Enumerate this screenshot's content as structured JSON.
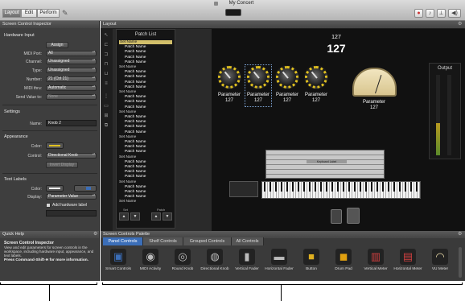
{
  "window": {
    "title": "My Concert"
  },
  "toolbar": {
    "modes": [
      "Layout",
      "Edit",
      "Perform"
    ],
    "active_mode": "Layout"
  },
  "inspector": {
    "title": "Screen Control Inspector",
    "hardware_input": {
      "heading": "Hardware Input",
      "assign_label": "Assign",
      "fields": [
        {
          "label": "MIDI Port:",
          "value": "All"
        },
        {
          "label": "Channel:",
          "value": "Unassigned"
        },
        {
          "label": "Type:",
          "value": "Unassigned"
        },
        {
          "label": "Number:",
          "value": "21 (Ctrl 21)"
        },
        {
          "label": "MIDI thru:",
          "value": "Automatic"
        },
        {
          "label": "Send Value to:",
          "value": "None"
        }
      ]
    },
    "settings": {
      "heading": "Settings",
      "name_label": "Name:",
      "name_value": "Knob 2"
    },
    "appearance": {
      "heading": "Appearance",
      "color_label": "Color:",
      "control_label": "Control:",
      "control_value": "Directional Knob",
      "invert_label": "Invert Display"
    },
    "text_labels": {
      "heading": "Text Labels",
      "color_label": "Color:",
      "display_label": "Display:",
      "display_value": "Parameter Value",
      "add_label": "Add hardware label"
    }
  },
  "quick_help": {
    "title": "Quick Help",
    "heading": "Screen Control Inspector",
    "body": "View and edit parameters for screen controls in the workspace, including hardware input, appearance, and text labels.",
    "hint": "Press Command-Shift-H for more information."
  },
  "layout": {
    "title": "Layout",
    "patch_list": {
      "title": "Patch List",
      "items": [
        {
          "kind": "set",
          "text": "Set Name",
          "selected": true
        },
        {
          "kind": "patch",
          "text": "Patch Name"
        },
        {
          "kind": "patch",
          "text": "Patch Name"
        },
        {
          "kind": "patch",
          "text": "Patch Name"
        },
        {
          "kind": "patch",
          "text": "Patch Name"
        },
        {
          "kind": "set",
          "text": "Set Name"
        },
        {
          "kind": "patch",
          "text": "Patch Name"
        },
        {
          "kind": "patch",
          "text": "Patch Name"
        },
        {
          "kind": "patch",
          "text": "Patch Name"
        },
        {
          "kind": "patch",
          "text": "Patch Name"
        },
        {
          "kind": "set",
          "text": "Set Name"
        },
        {
          "kind": "patch",
          "text": "Patch Name"
        },
        {
          "kind": "patch",
          "text": "Patch Name"
        },
        {
          "kind": "patch",
          "text": "Patch Name"
        },
        {
          "kind": "set",
          "text": "Set Name"
        },
        {
          "kind": "patch",
          "text": "Patch Name"
        },
        {
          "kind": "patch",
          "text": "Patch Name"
        },
        {
          "kind": "patch",
          "text": "Patch Name"
        },
        {
          "kind": "patch",
          "text": "Patch Name"
        },
        {
          "kind": "set",
          "text": "Set Name"
        },
        {
          "kind": "patch",
          "text": "Patch Name"
        },
        {
          "kind": "patch",
          "text": "Patch Name"
        },
        {
          "kind": "patch",
          "text": "Patch Name"
        },
        {
          "kind": "set",
          "text": "Set Name"
        },
        {
          "kind": "patch",
          "text": "Patch Name"
        },
        {
          "kind": "patch",
          "text": "Patch Name"
        },
        {
          "kind": "patch",
          "text": "Patch Name"
        },
        {
          "kind": "patch",
          "text": "Patch Name"
        },
        {
          "kind": "set",
          "text": "Set Name"
        },
        {
          "kind": "patch",
          "text": "Patch Name"
        },
        {
          "kind": "patch",
          "text": "Patch Name"
        },
        {
          "kind": "patch",
          "text": "Patch Name"
        },
        {
          "kind": "set",
          "text": "Set Name"
        }
      ],
      "footer_left": "Set",
      "footer_right": "Patch"
    },
    "display": {
      "small": "127",
      "large": "127"
    },
    "knobs": [
      {
        "label": "Parameter",
        "value": "127"
      },
      {
        "label": "Parameter",
        "value": "127"
      },
      {
        "label": "Parameter",
        "value": "127"
      },
      {
        "label": "Parameter",
        "value": "127"
      }
    ],
    "meter": {
      "label": "Parameter",
      "value": "127"
    },
    "output_label": "Output",
    "keyboard_label": "Keyboard Label"
  },
  "palette": {
    "title": "Screen Controls Palette",
    "tabs": [
      "Panel Controls",
      "Shelf Controls",
      "Grouped Controls",
      "All Controls"
    ],
    "active_tab": "Panel Controls",
    "items": [
      {
        "label": "Smart Controls",
        "icon": "smart-controls-icon"
      },
      {
        "label": "MIDI Activity",
        "icon": "midi-activity-icon"
      },
      {
        "label": "Round Knob",
        "icon": "round-knob-icon"
      },
      {
        "label": "Directional Knob",
        "icon": "directional-knob-icon"
      },
      {
        "label": "Vertical Fader",
        "icon": "vertical-fader-icon"
      },
      {
        "label": "Horizontal Fader",
        "icon": "horizontal-fader-icon"
      },
      {
        "label": "Button",
        "icon": "button-icon"
      },
      {
        "label": "Drum Pad",
        "icon": "drum-pad-icon"
      },
      {
        "label": "Vertical Meter",
        "icon": "vertical-meter-icon"
      },
      {
        "label": "Horizontal Meter",
        "icon": "horizontal-meter-icon"
      },
      {
        "label": "VU Meter",
        "icon": "vu-meter-icon"
      }
    ]
  },
  "colors": {
    "accent_blue": "#3b6eb8",
    "knob_ring": "#e0c020",
    "patch_selected": "#d2bf6a"
  }
}
